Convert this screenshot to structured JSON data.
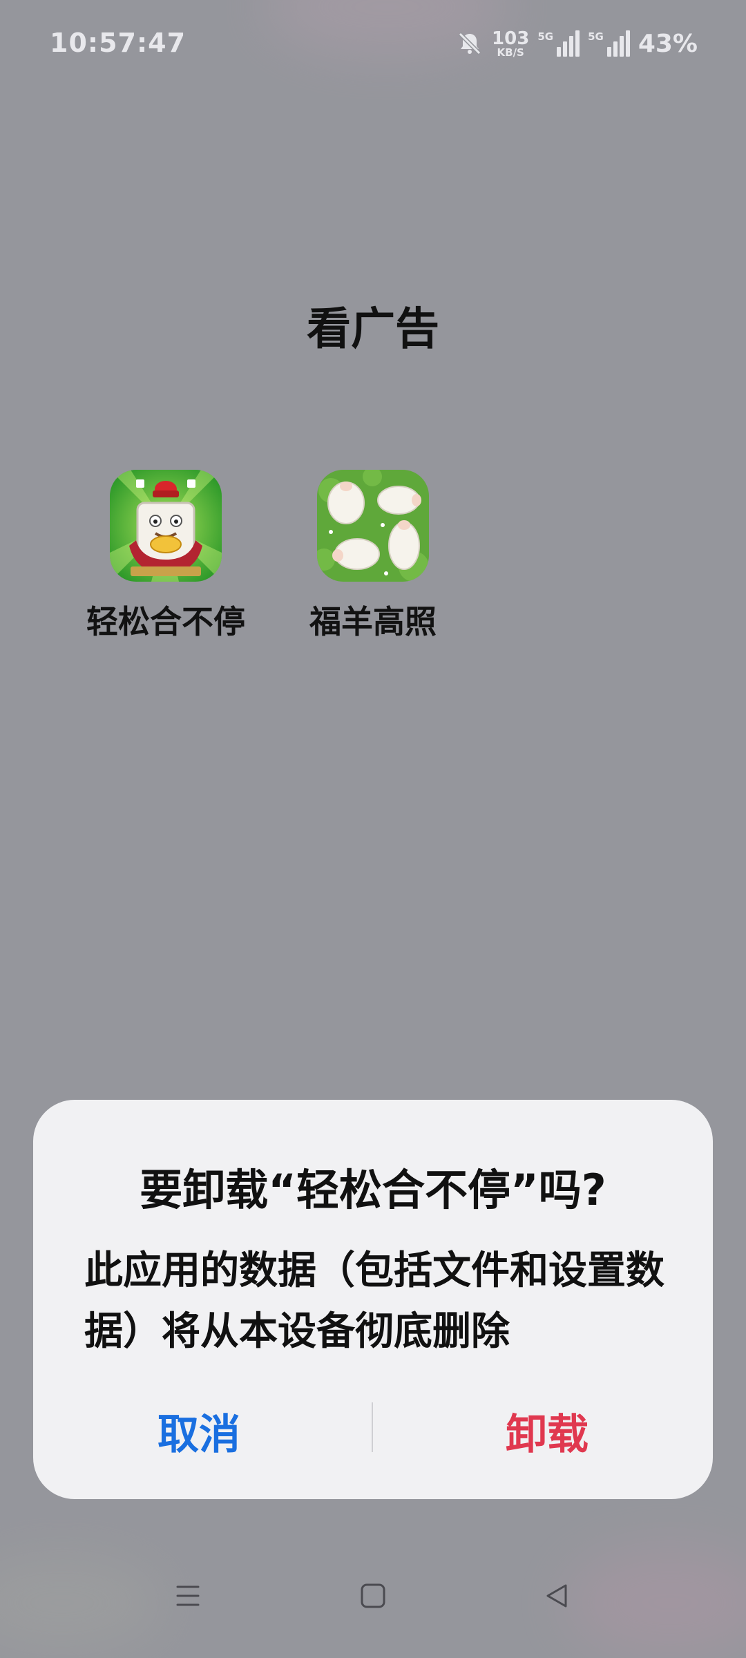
{
  "status_bar": {
    "time": "10:57:47",
    "net_speed_value": "103",
    "net_speed_unit": "KB/S",
    "sim1_label": "5G",
    "sim2_label": "5G",
    "battery": "43%",
    "icons": [
      "mute-bell-icon",
      "signal-icon",
      "signal-icon"
    ]
  },
  "page": {
    "title": "看广告"
  },
  "apps": [
    {
      "label": "轻松合不停",
      "icon": "mahjong-god-of-wealth-icon"
    },
    {
      "label": "福羊高照",
      "icon": "sheep-on-grass-icon"
    }
  ],
  "dialog": {
    "title": "要卸载“轻松合不停”吗?",
    "body": "此应用的数据（包括文件和设置数据）将从本设备彻底删除",
    "cancel_label": "取消",
    "uninstall_label": "卸载",
    "cancel_color": "#1a6fe0",
    "uninstall_color": "#e0384f"
  },
  "nav_bar": {
    "icons": [
      "menu-icon",
      "home-icon",
      "back-icon"
    ]
  }
}
